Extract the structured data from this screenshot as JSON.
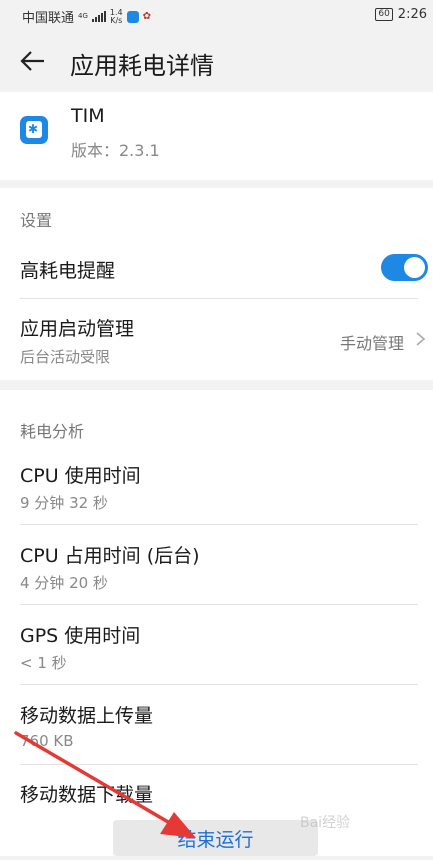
{
  "status_bar": {
    "carrier": "中国联通",
    "network_type": "4G",
    "speed_value": "1.4",
    "speed_unit": "K/s",
    "battery": "60",
    "time": "2:26"
  },
  "header": {
    "title": "应用耗电详情"
  },
  "app": {
    "name": "TIM",
    "version": "版本：2.3.1"
  },
  "settings": {
    "section_title": "设置",
    "high_power_alert": {
      "label": "高耗电提醒",
      "enabled": true
    },
    "launch_management": {
      "label": "应用启动管理",
      "subtitle": "后台活动受限",
      "value": "手动管理"
    }
  },
  "analysis": {
    "section_title": "耗电分析",
    "items": [
      {
        "label": "CPU 使用时间",
        "value": "9 分钟 32 秒"
      },
      {
        "label": "CPU 占用时间 (后台)",
        "value": "4 分钟 20 秒"
      },
      {
        "label": "GPS 使用时间",
        "value": "< 1 秒"
      },
      {
        "label": "移动数据上传量",
        "value": "760 KB"
      },
      {
        "label": "移动数据下载量",
        "value": ""
      }
    ]
  },
  "actions": {
    "end_button": "结束运行"
  },
  "colors": {
    "accent": "#1e88e5",
    "annotation_arrow": "#e53935"
  }
}
